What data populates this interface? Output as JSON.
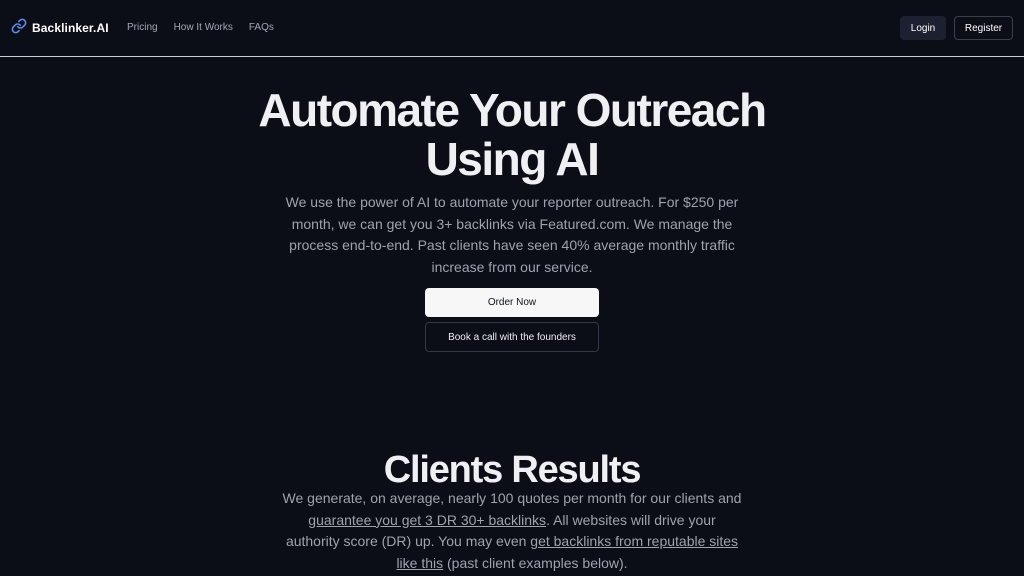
{
  "nav": {
    "brand": "Backlinker.AI",
    "brand_icon": "link-icon",
    "links": [
      "Pricing",
      "How It Works",
      "FAQs"
    ],
    "login_label": "Login",
    "register_label": "Register"
  },
  "hero": {
    "title_line1": "Automate Your Outreach",
    "title_line2": "Using AI",
    "description": "We use the power of AI to automate your reporter outreach. For $250 per month, we can get you 3+ backlinks via Featured.com. We manage the process end-to-end. Past clients have seen 40% average monthly traffic increase from our service.",
    "order_button": "Order Now",
    "book_button": "Book a call with the founders"
  },
  "results": {
    "title": "Clients Results",
    "text_1": "We generate, on average, nearly 100 quotes per month for our clients and ",
    "link_1": "guarantee you get 3 DR 30+ backlinks",
    "text_2": ". All websites will drive your authority score (DR) up. You may even ",
    "link_2": "get backlinks from reputable sites like this",
    "text_3": " (past client examples below)."
  },
  "colors": {
    "background": "#0b0d17",
    "primary_button": "#f7f7f8",
    "muted_text": "#9ea3ae"
  }
}
